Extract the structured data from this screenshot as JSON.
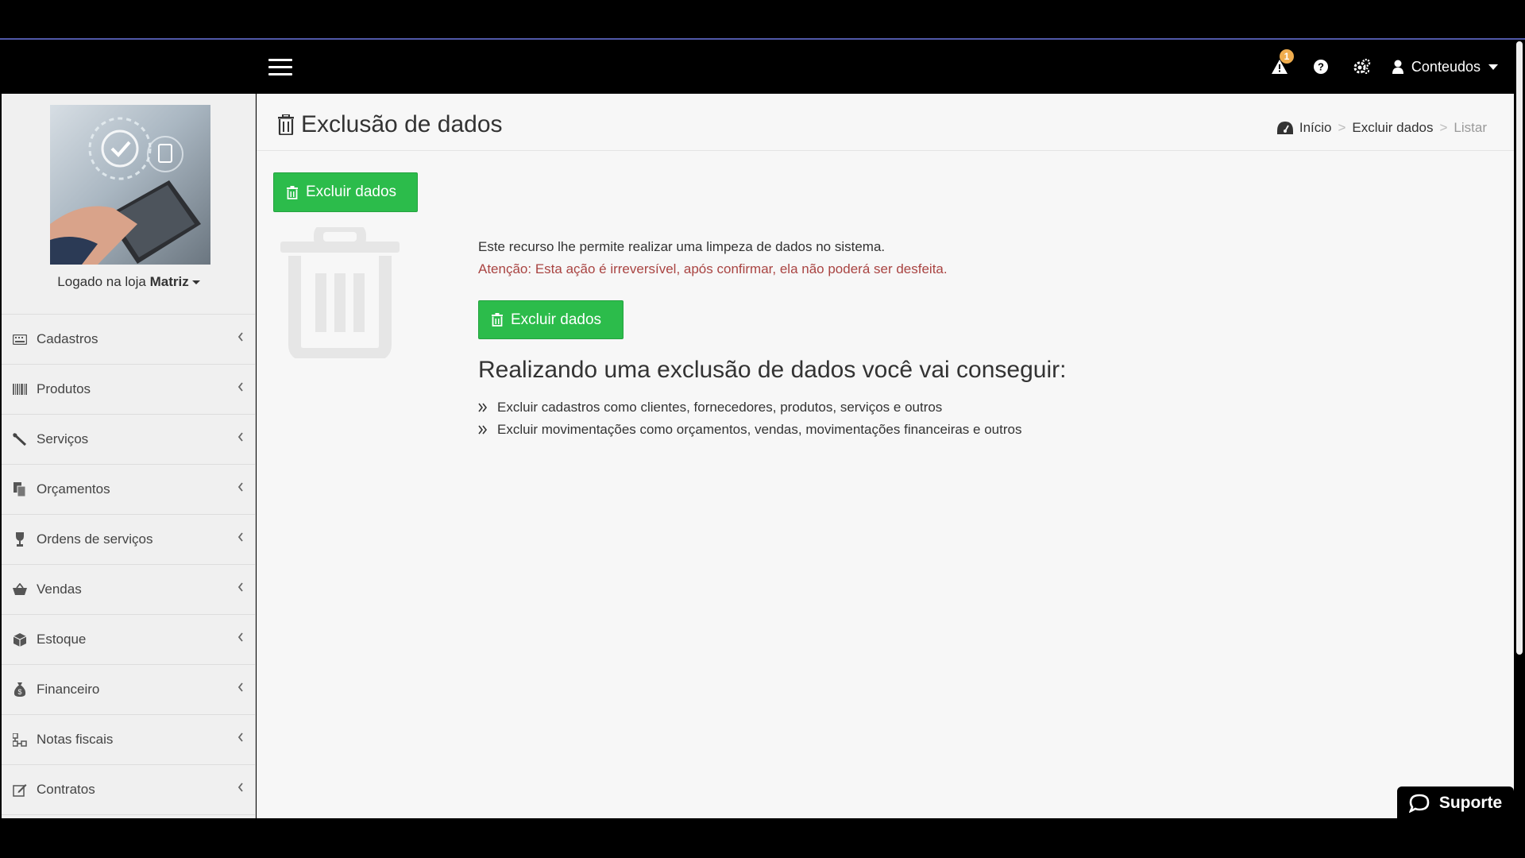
{
  "topbar": {
    "notification_count": "1",
    "user_label": "Conteudos",
    "icons": [
      "menu-icon",
      "warning-icon",
      "help-icon",
      "settings-icon",
      "user-icon"
    ]
  },
  "sidebar": {
    "store_prefix": "Logado na loja",
    "store_name": "Matriz",
    "items": [
      {
        "label": "Cadastros",
        "icon": "keyboard-icon"
      },
      {
        "label": "Produtos",
        "icon": "barcode-icon"
      },
      {
        "label": "Serviços",
        "icon": "wrench-icon"
      },
      {
        "label": "Orçamentos",
        "icon": "files-icon"
      },
      {
        "label": "Ordens de serviços",
        "icon": "trophy-icon"
      },
      {
        "label": "Vendas",
        "icon": "basket-icon"
      },
      {
        "label": "Estoque",
        "icon": "cube-icon"
      },
      {
        "label": "Financeiro",
        "icon": "money-bag-icon"
      },
      {
        "label": "Notas fiscais",
        "icon": "sitemap-icon"
      },
      {
        "label": "Contratos",
        "icon": "edit-icon"
      }
    ]
  },
  "header": {
    "title": "Exclusão de dados",
    "breadcrumb": {
      "home": "Início",
      "section": "Excluir dados",
      "current": "Listar",
      "separator": ">"
    }
  },
  "content": {
    "button_label": "Excluir dados",
    "description": "Este recurso lhe permite realizar uma limpeza de dados no sistema.",
    "warning": "Atenção: Esta ação é irreversível, após confirmar, ela não poderá ser desfeita.",
    "benefits_title": "Realizando uma exclusão de dados você vai conseguir:",
    "benefits": [
      "Excluir cadastros como clientes, fornecedores, produtos, serviços e outros",
      "Excluir movimentações como orçamentos, vendas, movimentações financeiras e outros"
    ]
  },
  "support": {
    "label": "Suporte"
  },
  "colors": {
    "green": "#2cbc4b",
    "warning_text": "#a94442",
    "topbar": "#000000",
    "badge": "#f0ad4e"
  }
}
